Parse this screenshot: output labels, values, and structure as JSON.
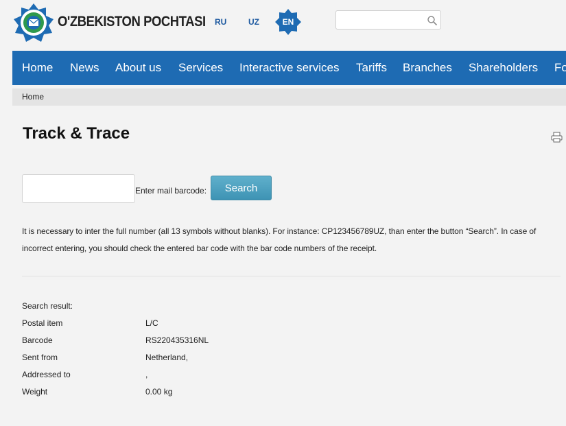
{
  "header": {
    "brand_name": "O'ZBEKISTON POCHTASI",
    "logo_icon": "uzbekistan-post-emblem-icon",
    "languages": {
      "ru": "RU",
      "uz": "UZ",
      "en": "EN"
    },
    "active_language": "EN",
    "search": {
      "value": "",
      "placeholder": "",
      "icon": "magnifier-icon"
    }
  },
  "nav": {
    "items": [
      "Home",
      "News",
      "About us",
      "Services",
      "Interactive services",
      "Tariffs",
      "Branches",
      "Shareholders",
      "Fo"
    ]
  },
  "breadcrumb": {
    "home": "Home"
  },
  "page": {
    "title": "Track & Trace",
    "print_icon": "printer-icon",
    "barcode_input_value": "",
    "barcode_label": "Enter mail barcode:",
    "search_button": "Search",
    "info_line1": "It is necessary to inter the full number (all 13 symbols without blanks). For instance: CP123456789UZ, than enter the button “Search”. In case of",
    "info_line2": "incorrect entering, you should check the entered bar code with the bar code numbers of the receipt."
  },
  "result": {
    "heading": "Search result:",
    "rows": [
      {
        "label": "Postal item",
        "value": "L/C"
      },
      {
        "label": "Barcode",
        "value": "RS220435316NL"
      },
      {
        "label": "Sent from",
        "value": "Netherland,"
      },
      {
        "label": "Addressed to",
        "value": ","
      },
      {
        "label": "Weight",
        "value": "0.00 kg"
      }
    ]
  },
  "colors": {
    "nav_bg": "#1e6bb3",
    "button_bg": "#4a9fc0",
    "active_lang_bg": "#1e6bb3",
    "page_bg": "#f3f3f3"
  }
}
